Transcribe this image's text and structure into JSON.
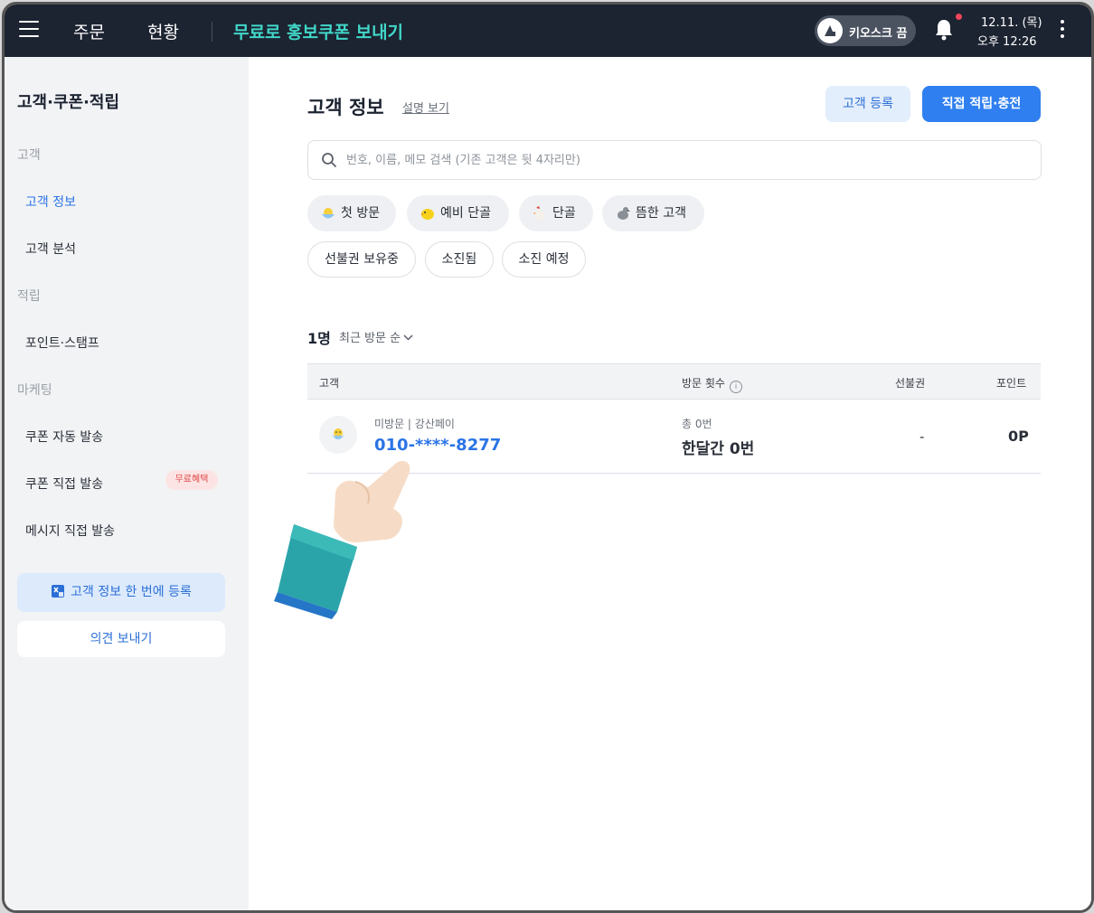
{
  "topbar": {
    "nav": [
      "주문",
      "현황"
    ],
    "promo": "무료로 홍보쿠폰 보내기",
    "kiosk": "키오스크 끔",
    "date": "12.11. (목)",
    "time": "오후 12:26"
  },
  "sidebar": {
    "title": "고객·쿠폰·적립",
    "sections": {
      "customer": "고객",
      "points": "적립",
      "marketing": "마케팅"
    },
    "items": {
      "customer_info": "고객 정보",
      "customer_analysis": "고객 분석",
      "point_stamp": "포인트·스탬프",
      "coupon_auto": "쿠폰 자동 발송",
      "coupon_direct": "쿠폰 직접 발송",
      "message_direct": "메시지 직접 발송"
    },
    "badge_free": "무료혜택",
    "bulk_register": "고객 정보 한 번에 등록",
    "feedback": "의견 보내기"
  },
  "main": {
    "title": "고객 정보",
    "help": "설명 보기",
    "register_btn": "고객 등록",
    "earn_btn": "직접 적립·충전",
    "search_placeholder": "번호, 이름, 메모 검색 (기존 고객은 뒷 4자리만)",
    "chips_row1": [
      "첫 방문",
      "예비 단골",
      "단골",
      "뜸한 고객"
    ],
    "chips_row2": [
      "선불권 보유중",
      "소진됨",
      "소진 예정"
    ],
    "count": "1명",
    "sort": "최근 방문 순",
    "table": {
      "headers": [
        "고객",
        "방문 횟수",
        "선불권",
        "포인트"
      ],
      "rows": [
        {
          "sub": "미방문 | 강산페이",
          "phone": "010-****-8277",
          "visit_total": "총 0번",
          "visit_month": "한달간 0번",
          "prepaid": "-",
          "points": "0P"
        }
      ]
    }
  },
  "colors": {
    "topbar": "#1c2331",
    "promo": "#41d7c8",
    "accent": "#2f7ff0",
    "sidebar_bg": "#f2f3f5"
  }
}
